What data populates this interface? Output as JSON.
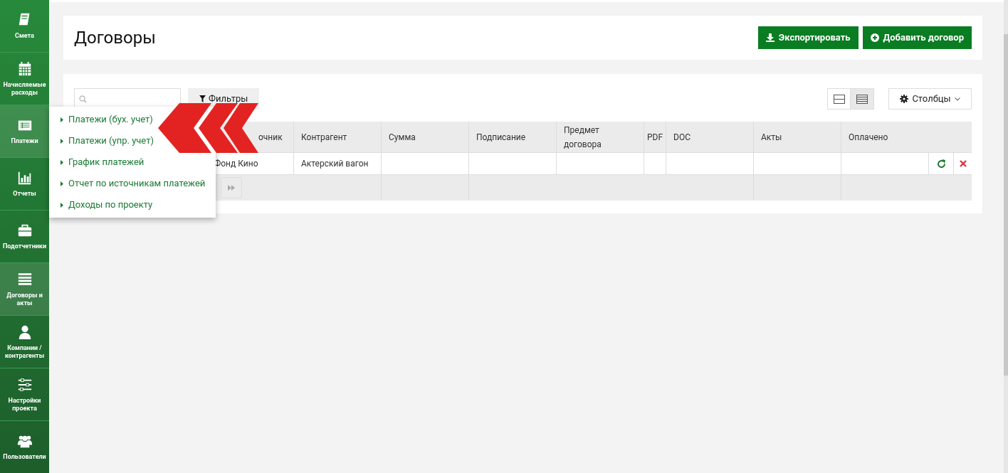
{
  "sidebar": {
    "items": [
      {
        "label": "Смета",
        "selected": false
      },
      {
        "label": "Начисляемые расходы",
        "selected": false
      },
      {
        "label": "Платежи",
        "selected": true
      },
      {
        "label": "Отчеты",
        "selected": false
      },
      {
        "label": "Подотчетники",
        "selected": false
      },
      {
        "label": "Договоры и акты",
        "selected": true
      },
      {
        "label": "Компании / контрагенты",
        "selected": false
      },
      {
        "label": "Настройки проекта",
        "selected": false
      },
      {
        "label": "Пользователи",
        "selected": false
      }
    ]
  },
  "submenu": {
    "items": [
      "Платежи (бух. учет)",
      "Платежи (упр. учет)",
      "График платежей",
      "Отчет по источникам платежей",
      "Доходы по проекту"
    ]
  },
  "page": {
    "title": "Договоры",
    "buttons": [
      "Экспортировать",
      "Добавить договор"
    ]
  },
  "toolbar": {
    "filters": "Фильтры",
    "view_modes": [
      {
        "selected": false
      },
      {
        "selected": true
      }
    ],
    "columns_button": "Столбцы"
  },
  "table": {
    "columns": [
      "",
      "очник",
      "Контрагент",
      "Сумма",
      "Подписание",
      "Предмет договора",
      "PDF",
      "DOC",
      "Акты",
      "Оплачено"
    ],
    "rows": [
      [
        "",
        "Фонд Кино",
        "Актерский вагон",
        "",
        "",
        "",
        "",
        "",
        "",
        ""
      ]
    ]
  }
}
